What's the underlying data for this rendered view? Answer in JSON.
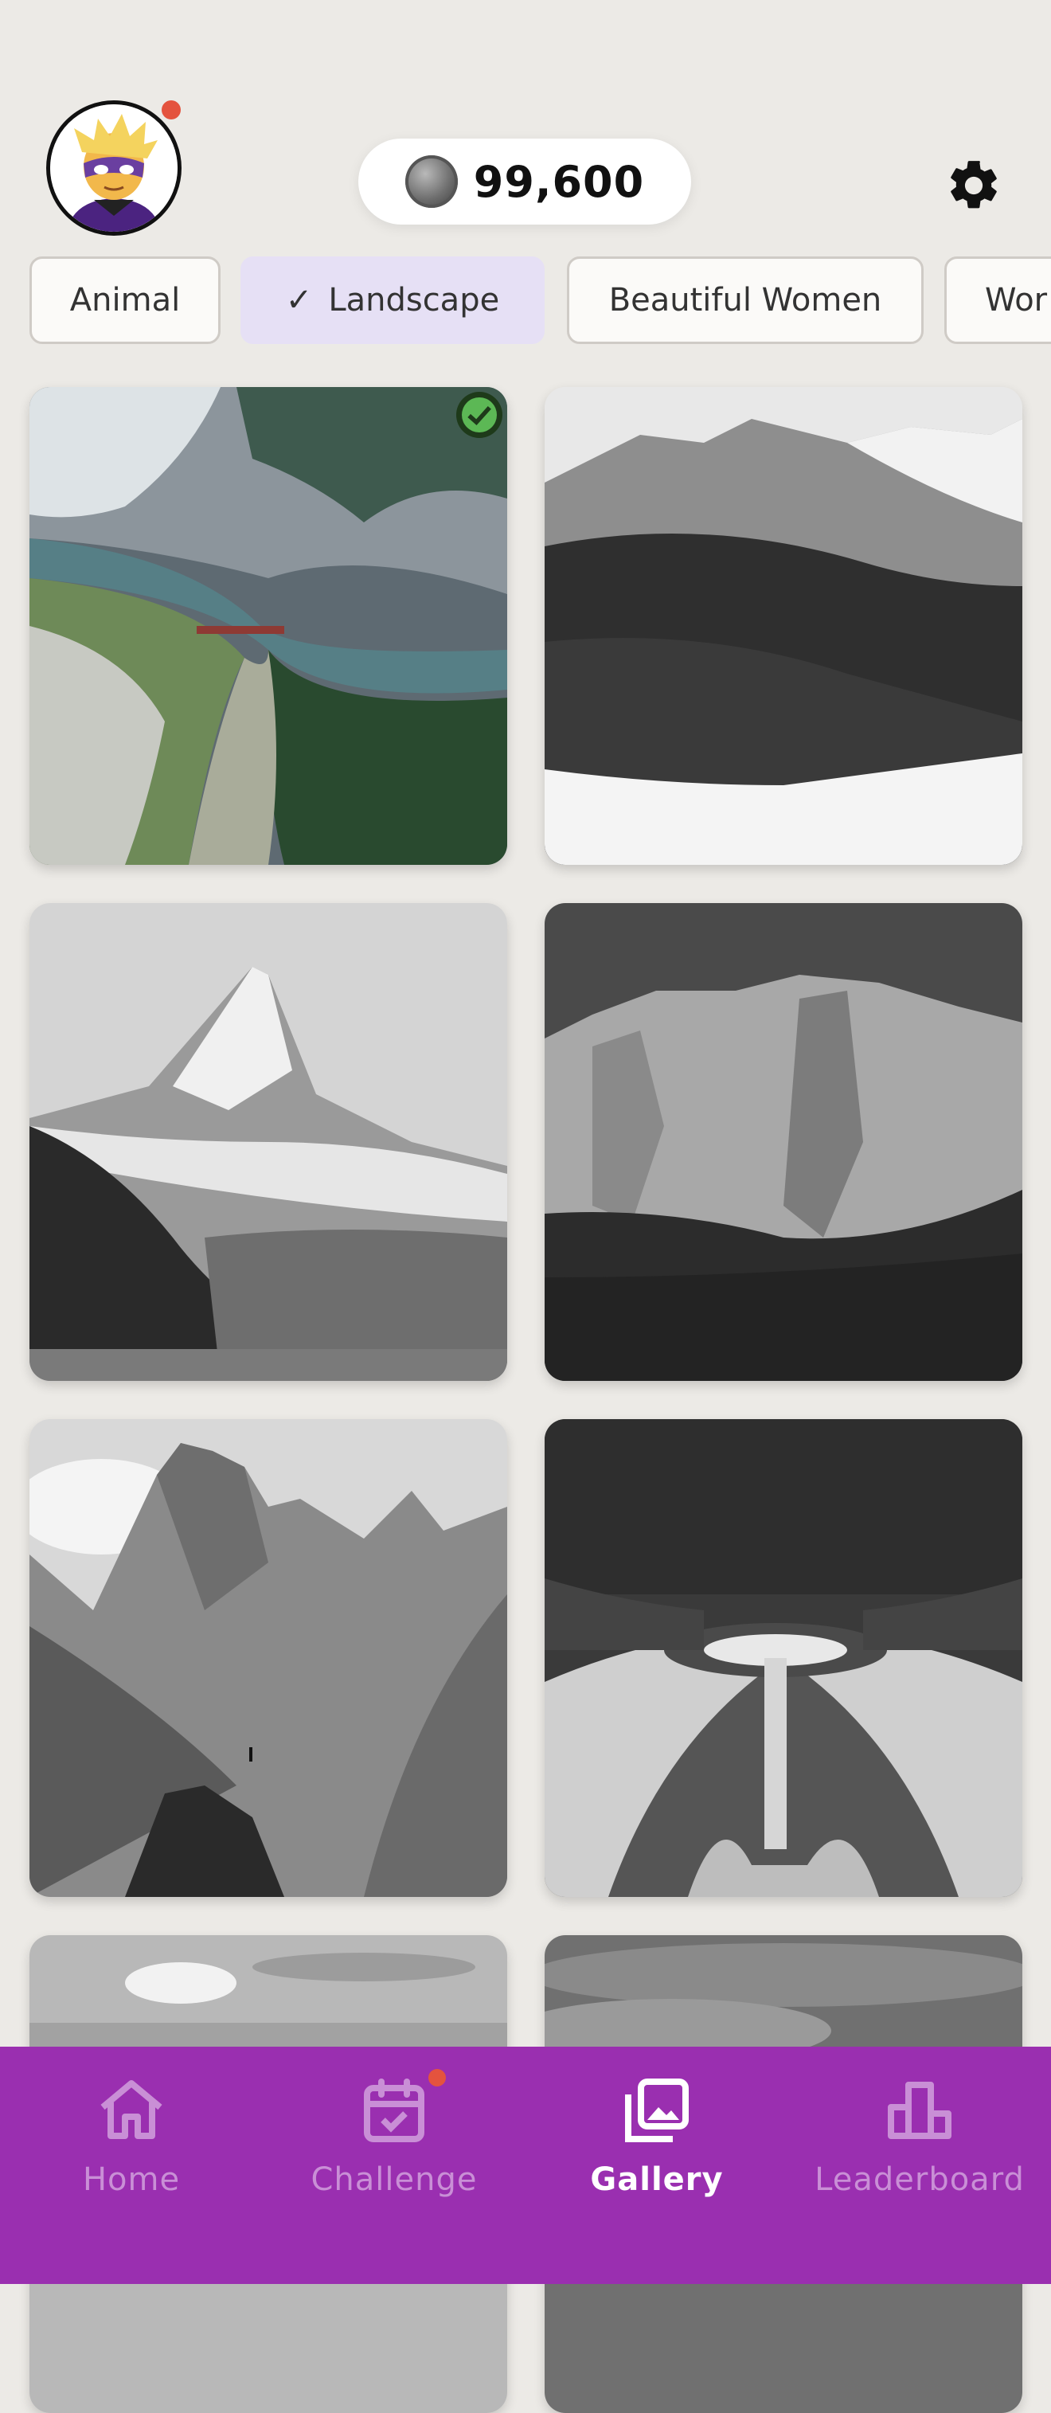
{
  "header": {
    "coin_balance": "99,600",
    "avatar_has_notification": true
  },
  "categories": [
    {
      "label": "Animal",
      "selected": false
    },
    {
      "label": "Landscape",
      "selected": true
    },
    {
      "label": "Beautiful Women",
      "selected": false
    },
    {
      "label": "Wor",
      "selected": false
    }
  ],
  "gallery": [
    {
      "subject": "aerial river valley with bridge",
      "colored": true,
      "completed": true
    },
    {
      "subject": "snowy forested mountains",
      "colored": false,
      "completed": false
    },
    {
      "subject": "matterhorn peak",
      "colored": false,
      "completed": false
    },
    {
      "subject": "rocky cliff face",
      "colored": false,
      "completed": false
    },
    {
      "subject": "jagged peaks with hiker",
      "colored": false,
      "completed": false
    },
    {
      "subject": "formal garden with canal",
      "colored": false,
      "completed": false
    },
    {
      "subject": "sky with clouds",
      "colored": false,
      "completed": false
    },
    {
      "subject": "dark cloudy sky",
      "colored": false,
      "completed": false
    }
  ],
  "nav": [
    {
      "label": "Home",
      "icon": "home-icon",
      "active": false
    },
    {
      "label": "Challenge",
      "icon": "calendar-check-icon",
      "active": false,
      "badge": true
    },
    {
      "label": "Gallery",
      "icon": "gallery-icon",
      "active": true
    },
    {
      "label": "Leaderboard",
      "icon": "leaderboard-icon",
      "active": false
    }
  ],
  "colors": {
    "background": "#ECEAE6",
    "accent": "#9A2FB0",
    "chip_selected": "#E6E0F5",
    "badge": "#E4533E",
    "complete": "#5CB855"
  }
}
